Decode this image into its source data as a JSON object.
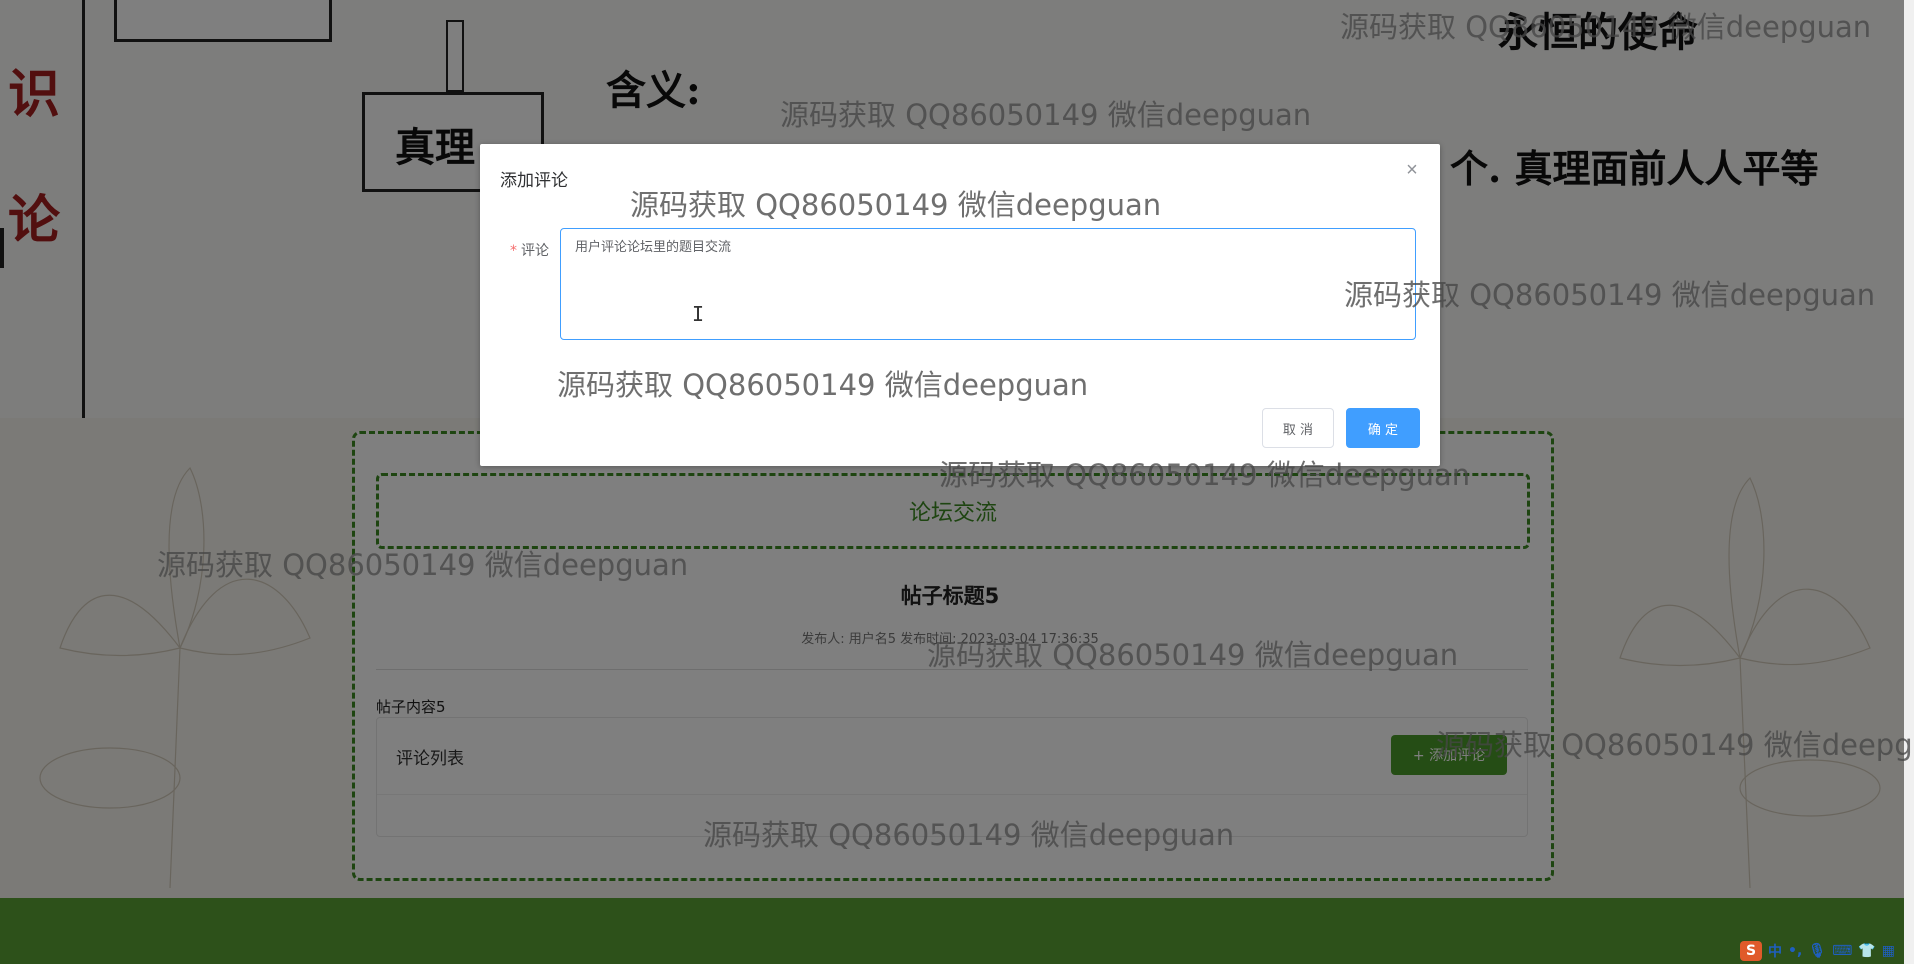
{
  "background": {
    "banner": {
      "chars": [
        "识",
        "论"
      ],
      "box_label": "真理",
      "meaning_label": "含义:",
      "heading_right": "永恒的使命",
      "line_text": "个. 真理面前人人平等"
    },
    "forum": {
      "header": "论坛交流",
      "post_title": "帖子标题5",
      "post_meta": "发布人: 用户名5  发布时间: 2023-03-04 17:36:35",
      "post_content": "帖子内容5",
      "comment_list_label": "评论列表",
      "add_comment_label": "+ 添加评论"
    },
    "colors": {
      "accent_green": "#4a9a2a",
      "primary_blue": "#409eff"
    }
  },
  "dialog": {
    "title": "添加评论",
    "close_icon": "close-icon",
    "form": {
      "required_mark": "*",
      "label": "评论",
      "value": "用户评论论坛里的题目交流"
    },
    "buttons": {
      "cancel": "取 消",
      "confirm": "确 定"
    }
  },
  "watermark": "源码获取 QQ86050149 微信deepguan",
  "tray": {
    "ime": "中"
  }
}
